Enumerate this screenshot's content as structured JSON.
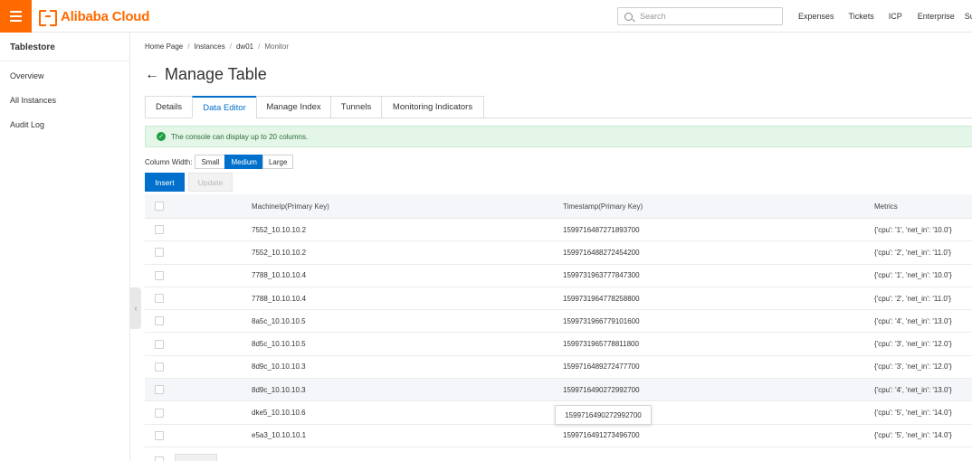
{
  "topbar": {
    "brand": "Alibaba Cloud",
    "search_placeholder": "Search",
    "nav": [
      "Expenses",
      "Tickets",
      "ICP",
      "Enterprise",
      "Su"
    ]
  },
  "sidebar": {
    "title": "Tablestore",
    "items": [
      "Overview",
      "All Instances",
      "Audit Log"
    ]
  },
  "breadcrumb": [
    "Home Page",
    "Instances",
    "dw01",
    "Monitor"
  ],
  "page_title": "Manage Table",
  "tabs": [
    "Details",
    "Data Editor",
    "Manage Index",
    "Tunnels",
    "Monitoring Indicators"
  ],
  "active_tab": "Data Editor",
  "alert": "The console can display up to 20 columns.",
  "column_width": {
    "label": "Column Width:",
    "options": [
      "Small",
      "Medium",
      "Large"
    ],
    "selected": "Medium"
  },
  "buttons": {
    "insert": "Insert",
    "update": "Update"
  },
  "table": {
    "headers": [
      "MachineIp(Primary Key)",
      "Timestamp(Primary Key)",
      "Metrics"
    ],
    "rows": [
      [
        "7552_10.10.10.2",
        "1599716487271893700",
        "{'cpu': '1', 'net_in': '10.0'}"
      ],
      [
        "7552_10.10.10.2",
        "1599716488272454200",
        "{'cpu': '2', 'net_in': '11.0'}"
      ],
      [
        "7788_10.10.10.4",
        "1599731963777847300",
        "{'cpu': '1', 'net_in': '10.0'}"
      ],
      [
        "7788_10.10.10.4",
        "1599731964778258800",
        "{'cpu': '2', 'net_in': '11.0'}"
      ],
      [
        "8a5c_10.10.10.5",
        "1599731966779101600",
        "{'cpu': '4', 'net_in': '13.0'}"
      ],
      [
        "8d5c_10.10.10.5",
        "1599731965778811800",
        "{'cpu': '3', 'net_in': '12.0'}"
      ],
      [
        "8d9c_10.10.10.3",
        "1599716489272477700",
        "{'cpu': '3', 'net_in': '12.0'}"
      ],
      [
        "8d9c_10.10.10.3",
        "1599716490272992700",
        "{'cpu': '4', 'net_in': '13.0'}"
      ],
      [
        "dke5_10.10.10.6",
        "",
        "{'cpu': '5', 'net_in': '14.0'}"
      ],
      [
        "e5a3_10.10.10.1",
        "1599716491273496700",
        "{'cpu': '5', 'net_in': '14.0'}"
      ]
    ],
    "hover_row": 7
  },
  "tooltip": "1599716490272992700",
  "colors": {
    "accent": "#0070cc",
    "brand": "#ff6a00",
    "success_bg": "#e4f6e7"
  }
}
